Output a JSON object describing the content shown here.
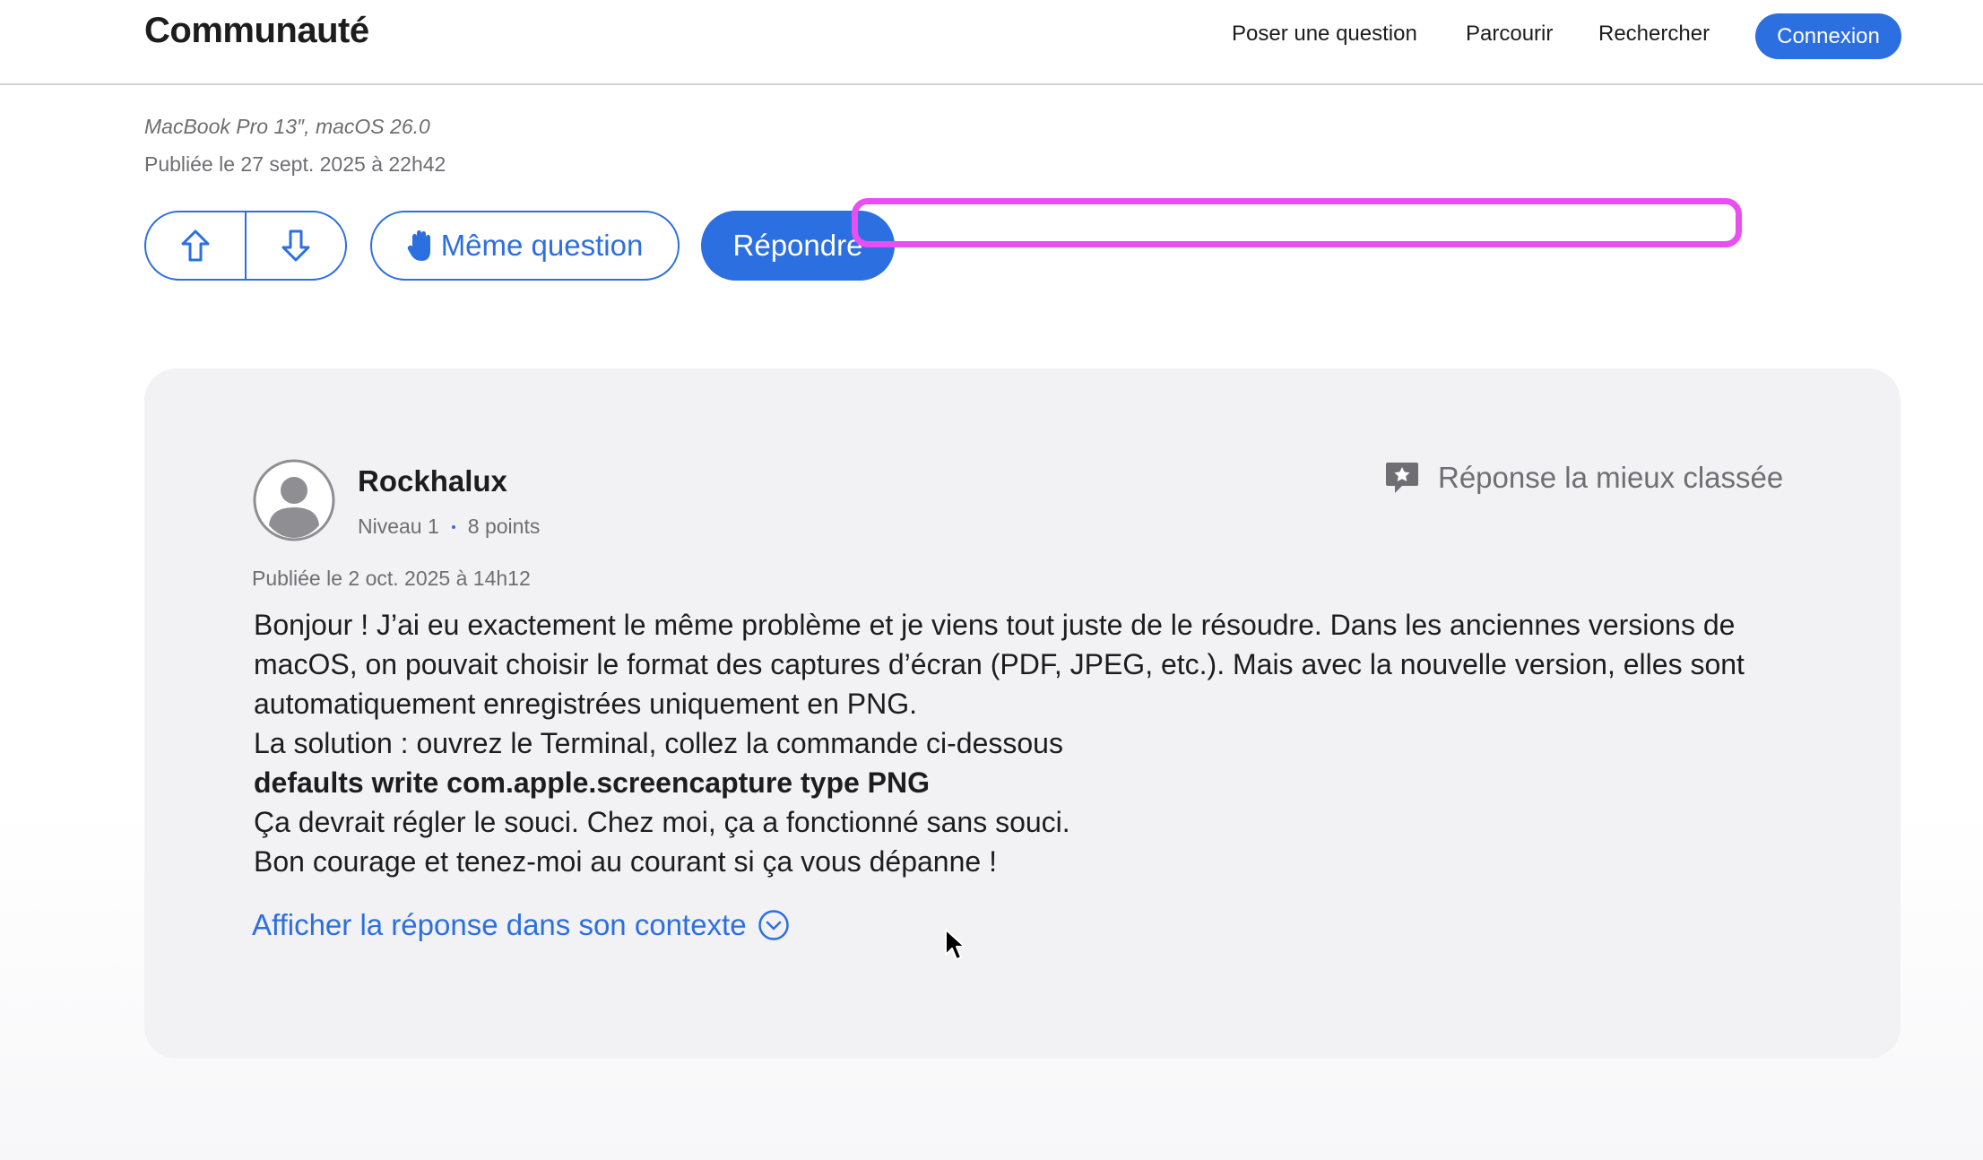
{
  "header": {
    "brand": "Communauté",
    "nav": [
      "Poser une question",
      "Parcourir",
      "Rechercher"
    ],
    "login_label": "Connexion"
  },
  "question": {
    "device": "MacBook Pro 13″, macOS 26.0",
    "posted": "Publiée le 27 sept. 2025 à 22h42",
    "same_question_label": "Même question",
    "reply_label": "Répondre"
  },
  "answer": {
    "author": "Rockhalux",
    "level": "Niveau 1",
    "points": "8 points",
    "badge_label": "Réponse la mieux classée",
    "posted": "Publiée le 2 oct. 2025 à 14h12",
    "paragraphs": [
      "Bonjour ! J’ai eu exactement le même problème et je viens tout juste de le résoudre. Dans les anciennes versions de macOS, on pouvait choisir le format des captures d’écran (PDF, JPEG, etc.). Mais avec la nouvelle version, elles sont automatiquement enregistrées uniquement en PNG.",
      "La solution : ouvrez le Terminal, collez la commande ci-dessous"
    ],
    "command": "defaults write com.apple.screencapture type PNG",
    "closing": [
      "Ça devrait régler le souci. Chez moi, ça a fonctionné sans souci.",
      "Bon courage et tenez-moi au courant si ça vous dépanne !"
    ],
    "context_link": "Afficher la réponse dans son contexte"
  },
  "icons": {
    "upvote": "arrow-up-icon",
    "downvote": "arrow-down-icon",
    "same_question": "raised-hand-icon",
    "avatar": "user-avatar-icon",
    "best_answer": "star-bubble-icon",
    "context": "chevron-down-circle-icon"
  },
  "colors": {
    "accent": "#2c6fe0",
    "highlight": "#e84ff0",
    "card": "#f2f2f5",
    "muted": "#6e6e73"
  }
}
